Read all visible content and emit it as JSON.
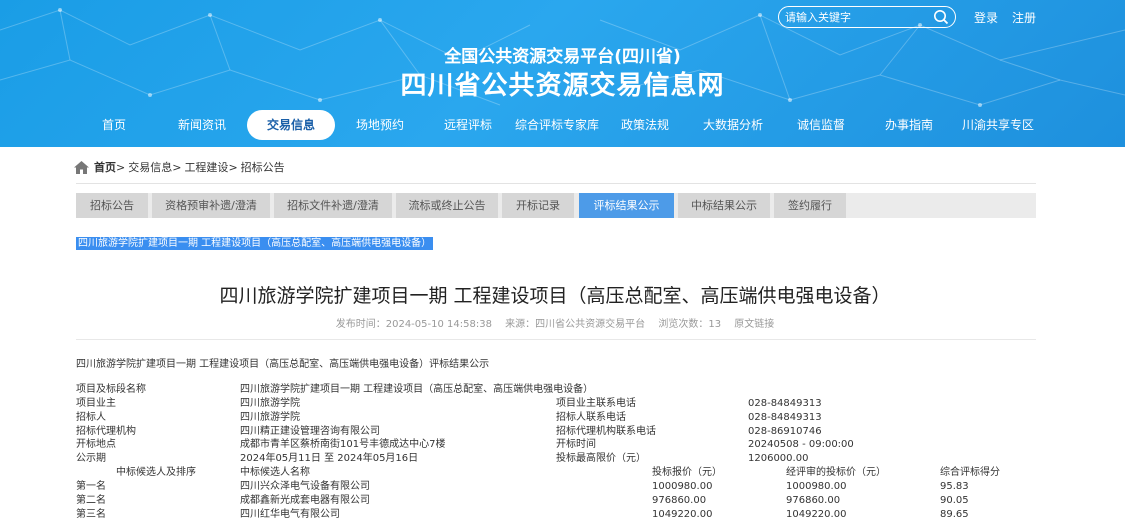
{
  "header": {
    "search_placeholder": "请输入关键字",
    "login": "登录",
    "register": "注册",
    "subtitle": "全国公共资源交易平台(四川省)",
    "title": "四川省公共资源交易信息网"
  },
  "nav": {
    "items": [
      "首页",
      "新闻资讯",
      "交易信息",
      "场地预约",
      "远程评标",
      "综合评标专家库",
      "政策法规",
      "大数据分析",
      "诚信监督",
      "办事指南",
      "川渝共享专区"
    ],
    "active_index": 2
  },
  "breadcrumb": {
    "home": "首页",
    "sep": ">",
    "items": [
      "交易信息",
      "工程建设",
      "招标公告"
    ]
  },
  "tabs": {
    "items": [
      "招标公告",
      "资格预审补遗/澄清",
      "招标文件补遗/澄清",
      "流标或终止公告",
      "开标记录",
      "评标结果公示",
      "中标结果公示",
      "签约履行"
    ],
    "active_index": 5
  },
  "selected_text": "四川旅游学院扩建项目一期 工程建设项目（高压总配室、高压端供电强电设备）",
  "article": {
    "title": "四川旅游学院扩建项目一期 工程建设项目（高压总配室、高压端供电强电设备）",
    "publish_time": "发布时间：2024-05-10 14:58:38",
    "source": "来源：四川省公共资源交易平台",
    "views": "浏览次数：13",
    "original_link": "原文链接",
    "announcement": "四川旅游学院扩建项目一期 工程建设项目（高压总配室、高压端供电强电设备）评标结果公示"
  },
  "info": {
    "project_name_label": "项目及标段名称",
    "project_name": "四川旅游学院扩建项目一期 工程建设项目（高压总配室、高压端供电强电设备）",
    "owner_label": "项目业主",
    "owner": "四川旅游学院",
    "owner_phone_label": "项目业主联系电话",
    "owner_phone": "028-84849313",
    "tenderer_label": "招标人",
    "tenderer": "四川旅游学院",
    "tenderer_phone_label": "招标人联系电话",
    "tenderer_phone": "028-84849313",
    "agency_label": "招标代理机构",
    "agency": "四川精正建设管理咨询有限公司",
    "agency_phone_label": "招标代理机构联系电话",
    "agency_phone": "028-86910746",
    "location_label": "开标地点",
    "location": "成都市青羊区蔡桥南街101号丰德成达中心7楼",
    "open_time_label": "开标时间",
    "open_time": "20240508 - 09:00:00",
    "period_label": "公示期",
    "period": "2024年05月11日 至 2024年05月16日",
    "max_price_label": "投标最高限价（元）",
    "max_price": "1206000.00"
  },
  "candidates": {
    "headers": [
      "中标候选人及排序",
      "中标候选人名称",
      "投标报价（元）",
      "经评审的投标价（元）",
      "综合评标得分"
    ],
    "rows": [
      [
        "第一名",
        "四川兴众泽电气设备有限公司",
        "1000980.00",
        "1000980.00",
        "95.83"
      ],
      [
        "第二名",
        "成都鑫新光成套电器有限公司",
        "976860.00",
        "976860.00",
        "90.05"
      ],
      [
        "第三名",
        "四川红华电气有限公司",
        "1049220.00",
        "1049220.00",
        "89.65"
      ]
    ]
  },
  "colors": {
    "header_blue": "#1e9be6",
    "tab_active": "#4d9be8",
    "selection": "#3a8ef0"
  }
}
